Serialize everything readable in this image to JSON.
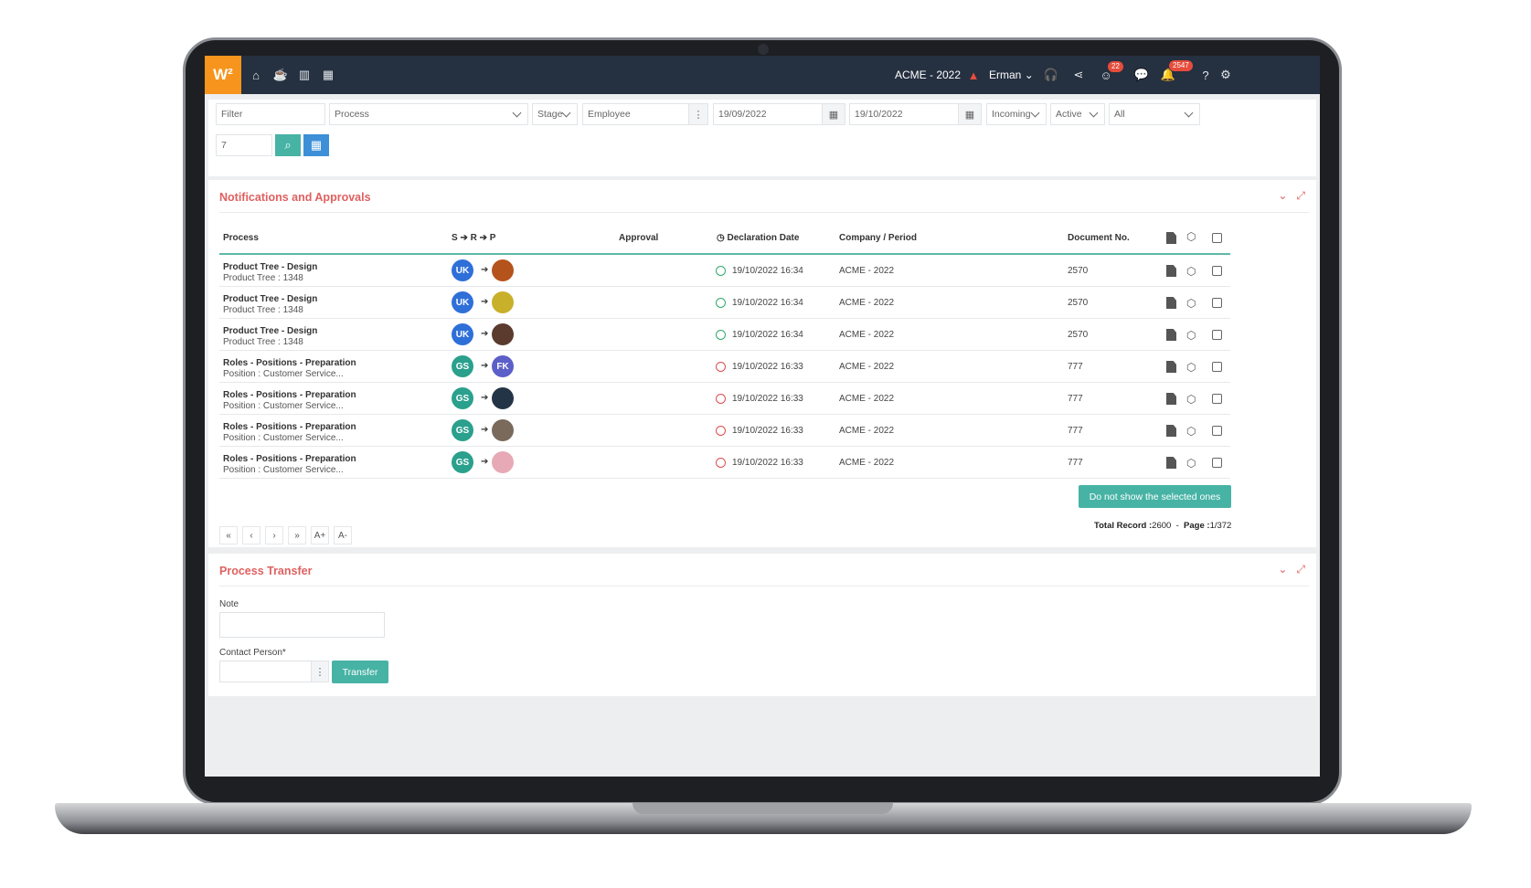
{
  "brand": {
    "logo_text": "W²",
    "accent": "#f7941d",
    "topbar_bg": "#253040",
    "teal": "#47b3a5",
    "title_red": "#e06060"
  },
  "topbar": {
    "company": "ACME - 2022",
    "user": "Erman",
    "chat_badge": "22",
    "notif_badge": "2547"
  },
  "filters": {
    "filter_placeholder": "Filter",
    "process": "Process",
    "stage": "Stage",
    "employee": "Employee",
    "date_from": "19/09/2022",
    "date_to": "19/10/2022",
    "direction": "Incoming",
    "state": "Active",
    "scope": "All",
    "count": "7"
  },
  "notifications": {
    "title": "Notifications and Approvals",
    "columns": {
      "process": "Process",
      "srp": "S ➔ R ➔ P",
      "approval": "Approval",
      "declaration_date": "Declaration Date",
      "company_period": "Company / Period",
      "document_no": "Document No."
    },
    "rows": [
      {
        "title": "Product Tree - Design",
        "sub": "Product Tree : 1348",
        "sender": "UK",
        "sender_color": "#2f6fd8",
        "receiver": "",
        "receiver_color": "#b5531c",
        "status": "ok",
        "date": "19/10/2022 16:34",
        "company": "ACME - 2022",
        "doc": "2570"
      },
      {
        "title": "Product Tree - Design",
        "sub": "Product Tree : 1348",
        "sender": "UK",
        "sender_color": "#2f6fd8",
        "receiver": "",
        "receiver_color": "#c8b02a",
        "status": "ok",
        "date": "19/10/2022 16:34",
        "company": "ACME - 2022",
        "doc": "2570"
      },
      {
        "title": "Product Tree - Design",
        "sub": "Product Tree : 1348",
        "sender": "UK",
        "sender_color": "#2f6fd8",
        "receiver": "",
        "receiver_color": "#5a3b2e",
        "status": "ok",
        "date": "19/10/2022 16:34",
        "company": "ACME - 2022",
        "doc": "2570"
      },
      {
        "title": "Roles - Positions - Preparation",
        "sub": "Position : Customer Service...",
        "sender": "GS",
        "sender_color": "#2aa08d",
        "receiver": "FK",
        "receiver_color": "#5b5fc7",
        "status": "late",
        "date": "19/10/2022 16:33",
        "company": "ACME - 2022",
        "doc": "777"
      },
      {
        "title": "Roles - Positions - Preparation",
        "sub": "Position : Customer Service...",
        "sender": "GS",
        "sender_color": "#2aa08d",
        "receiver": "",
        "receiver_color": "#243447",
        "status": "late",
        "date": "19/10/2022 16:33",
        "company": "ACME - 2022",
        "doc": "777"
      },
      {
        "title": "Roles - Positions - Preparation",
        "sub": "Position : Customer Service...",
        "sender": "GS",
        "sender_color": "#2aa08d",
        "receiver": "",
        "receiver_color": "#7a6a5c",
        "status": "late",
        "date": "19/10/2022 16:33",
        "company": "ACME - 2022",
        "doc": "777"
      },
      {
        "title": "Roles - Positions - Preparation",
        "sub": "Position : Customer Service...",
        "sender": "GS",
        "sender_color": "#2aa08d",
        "receiver": "",
        "receiver_color": "#e8a9b6",
        "status": "late",
        "date": "19/10/2022 16:33",
        "company": "ACME - 2022",
        "doc": "777"
      }
    ],
    "hide_selected_label": "Do not show the selected ones",
    "pager": {
      "first": "«",
      "prev": "‹",
      "next": "›",
      "last": "»",
      "font_up": "A+",
      "font_down": "A-"
    },
    "total_label": "Total Record :",
    "total_value": "2600",
    "separator": "-",
    "page_label": "Page :",
    "page_value": "1/372"
  },
  "transfer": {
    "title": "Process Transfer",
    "note_label": "Note",
    "contact_label": "Contact Person*",
    "transfer_label": "Transfer"
  }
}
